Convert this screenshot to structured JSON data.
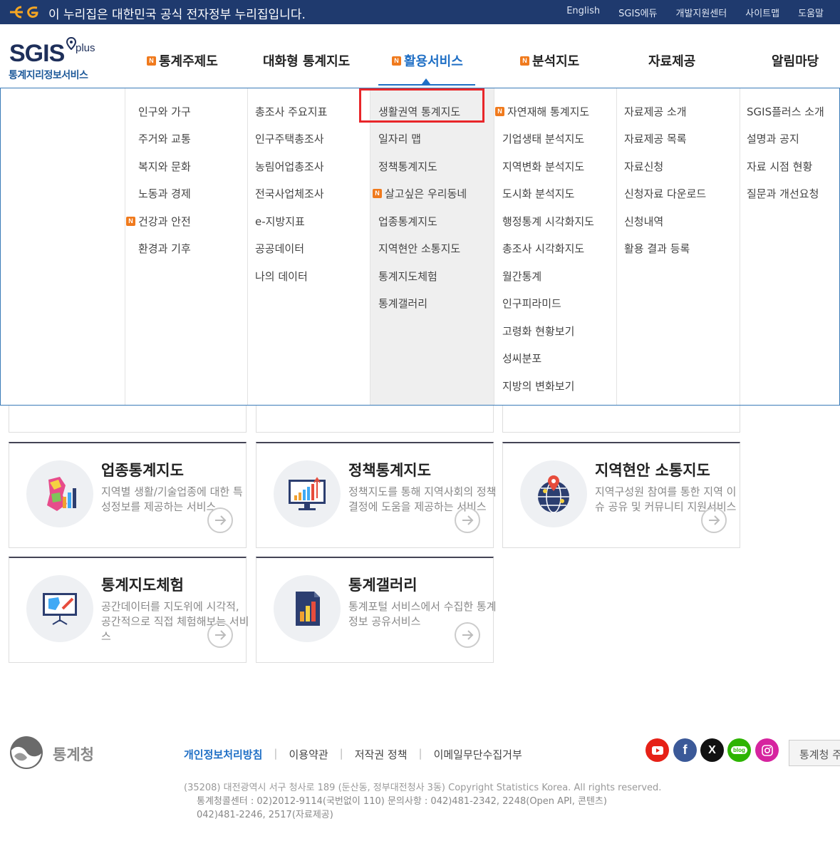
{
  "gov_bar": {
    "notice": "이 누리집은 대한민국 공식 전자정부 누리집입니다.",
    "links": [
      "English",
      "SGIS에듀",
      "개발지원센터",
      "사이트맵",
      "도움말"
    ]
  },
  "logo": {
    "main": "SGIS",
    "plus": "plus",
    "sub": "통계지리정보서비스"
  },
  "gnb": [
    {
      "label": "통계주제도",
      "new": true
    },
    {
      "label": "대화형 통계지도",
      "new": false
    },
    {
      "label": "활용서비스",
      "new": true
    },
    {
      "label": "분석지도",
      "new": true
    },
    {
      "label": "자료제공",
      "new": false
    },
    {
      "label": "알림마당",
      "new": false
    }
  ],
  "new_badge": "N",
  "mega_menu": {
    "col1": [
      "인구와 가구",
      "주거와 교통",
      "복지와 문화",
      "노동과 경제",
      "건강과 안전",
      "환경과 기후"
    ],
    "col2": [
      "총조사 주요지표",
      "인구주택총조사",
      "농림어업총조사",
      "전국사업체조사",
      "e-지방지표",
      "공공데이터",
      "나의 데이터"
    ],
    "col3": [
      "생활권역 통계지도",
      "일자리 맵",
      "정책통계지도",
      "살고싶은 우리동네",
      "업종통계지도",
      "지역현안 소통지도",
      "통계지도체험",
      "통계갤러리"
    ],
    "col4": [
      "자연재해 통계지도",
      "기업생태 분석지도",
      "지역변화 분석지도",
      "도시화 분석지도",
      "행정통계 시각화지도",
      "총조사 시각화지도",
      "월간통계",
      "인구피라미드",
      "고령화 현황보기",
      "성씨분포",
      "지방의 변화보기"
    ],
    "col5": [
      "자료제공 소개",
      "자료제공 목록",
      "자료신청",
      "신청자료 다운로드",
      "신청내역",
      "활용 결과 등록"
    ],
    "col6": [
      "SGIS플러스 소개",
      "설명과 공지",
      "자료 시점 현황",
      "질문과 개선요청"
    ]
  },
  "cards": [
    {
      "title": "업종통계지도",
      "desc": "지역별 생활/기술업종에 대한 특성정보를 제공하는 서비스"
    },
    {
      "title": "정책통계지도",
      "desc": "정책지도를 통해 지역사회의 정책결정에 도움을 제공하는 서비스"
    },
    {
      "title": "지역현안 소통지도",
      "desc": "지역구성원 참여를 통한 지역 이슈 공유 및 커뮤니티 지원서비스"
    },
    {
      "title": "통계지도체험",
      "desc": "공간데이터를 지도위에 시각적, 공간적으로 직접 체험해보는 서비스"
    },
    {
      "title": "통계갤러리",
      "desc": "통계포털 서비스에서 수집한 통계정보 공유서비스"
    }
  ],
  "footer": {
    "org": "통계청",
    "links": [
      "개인정보처리방침",
      "이용약관",
      "저작권 정책",
      "이메일무단수집거부"
    ],
    "address": "(35208) 대전광역시 서구 청사로 189 (둔산동, 정부대전청사 3동) Copyright Statistics Korea. All rights reserved.",
    "contact1": "통계청콜센터 : 02)2012-9114(국번없이 110) 문의사항 : 042)481-2342, 2248(Open API, 콘텐츠)",
    "contact2": "042)481-2246, 2517(자료제공)",
    "sns": [
      "youtube-icon",
      "facebook-icon",
      "x-icon",
      "blog-icon",
      "instagram-icon"
    ],
    "blog_label": "blog",
    "family_site": "통계청 주"
  }
}
